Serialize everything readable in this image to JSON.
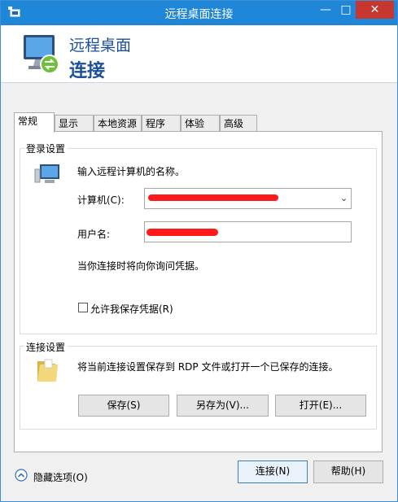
{
  "window": {
    "title": "远程桌面连接",
    "minimize_glyph": "—",
    "maximize_glyph": "□",
    "close_glyph": "✕"
  },
  "header": {
    "line1": "远程桌面",
    "line2": "连接"
  },
  "tabs": [
    {
      "label": "常规"
    },
    {
      "label": "显示"
    },
    {
      "label": "本地资源"
    },
    {
      "label": "程序"
    },
    {
      "label": "体验"
    },
    {
      "label": "高级"
    }
  ],
  "login_group": {
    "title": "登录设置",
    "instruction": "输入远程计算机的名称。",
    "computer_label": "计算机(C):",
    "username_label": "用户名:",
    "prompt_text": "当你连接时将向你询问凭据。",
    "save_credentials_label": "允许我保存凭据(R)",
    "save_credentials_checked": false
  },
  "connection_group": {
    "title": "连接设置",
    "description": "将当前连接设置保存到 RDP 文件或打开一个已保存的连接。",
    "save_label": "保存(S)",
    "save_as_label": "另存为(V)...",
    "open_label": "打开(E)..."
  },
  "footer": {
    "hide_options_label": "隐藏选项(O)",
    "connect_label": "连接(N)",
    "help_label": "帮助(H)"
  },
  "colors": {
    "titlebar": "#1f86d8",
    "close_button": "#c7362f",
    "header_text": "#1c4f9c",
    "redaction": "#ff1a1a"
  }
}
